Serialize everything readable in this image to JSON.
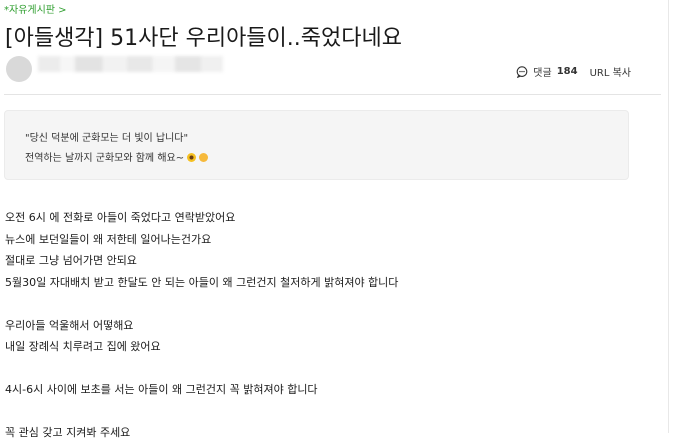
{
  "breadcrumb": "*자유게시판 >",
  "post": {
    "title": "[아들생각] 51사단 우리아들이..죽었다네요",
    "comment_label": "댓글",
    "comment_count": "184",
    "copy_url_label": "URL 복사"
  },
  "notice": {
    "line1": "\"당신 덕분에 군화모는 더 빛이 납니다\"",
    "line2": "전역하는 날까지 군화모와 함께 해요~"
  },
  "body_lines": [
    "오전 6시 에 전화로    아들이  죽었다고  연락받았어요",
    "뉴스에  보던일들이  왜  저한테  일어나는건가요",
    "절대로  그냥  넘어가면  안되요",
    " 5월30일  자대배치  받고  한달도   안  되는  아들이  왜  그런건지  철저하게  밝혀져야  합니다",
    "",
    "우리아들  억울해서  어떻해요",
    "내일  장례식   치루려고  집에  왔어요",
    "",
    "4시-6시  사이에 보초를  서는  아들이  왜  그런건지  꼭  밝혀져야 합니다",
    "",
    "꼭  관심  갖고   지켜봐  주세요"
  ],
  "colors": {
    "breadcrumb": "#2e9e2e",
    "notice_bg": "#f5f5f5"
  },
  "icons": [
    "comment-icon",
    "sunflower-emoji-icon",
    "smile-emoji-icon"
  ]
}
